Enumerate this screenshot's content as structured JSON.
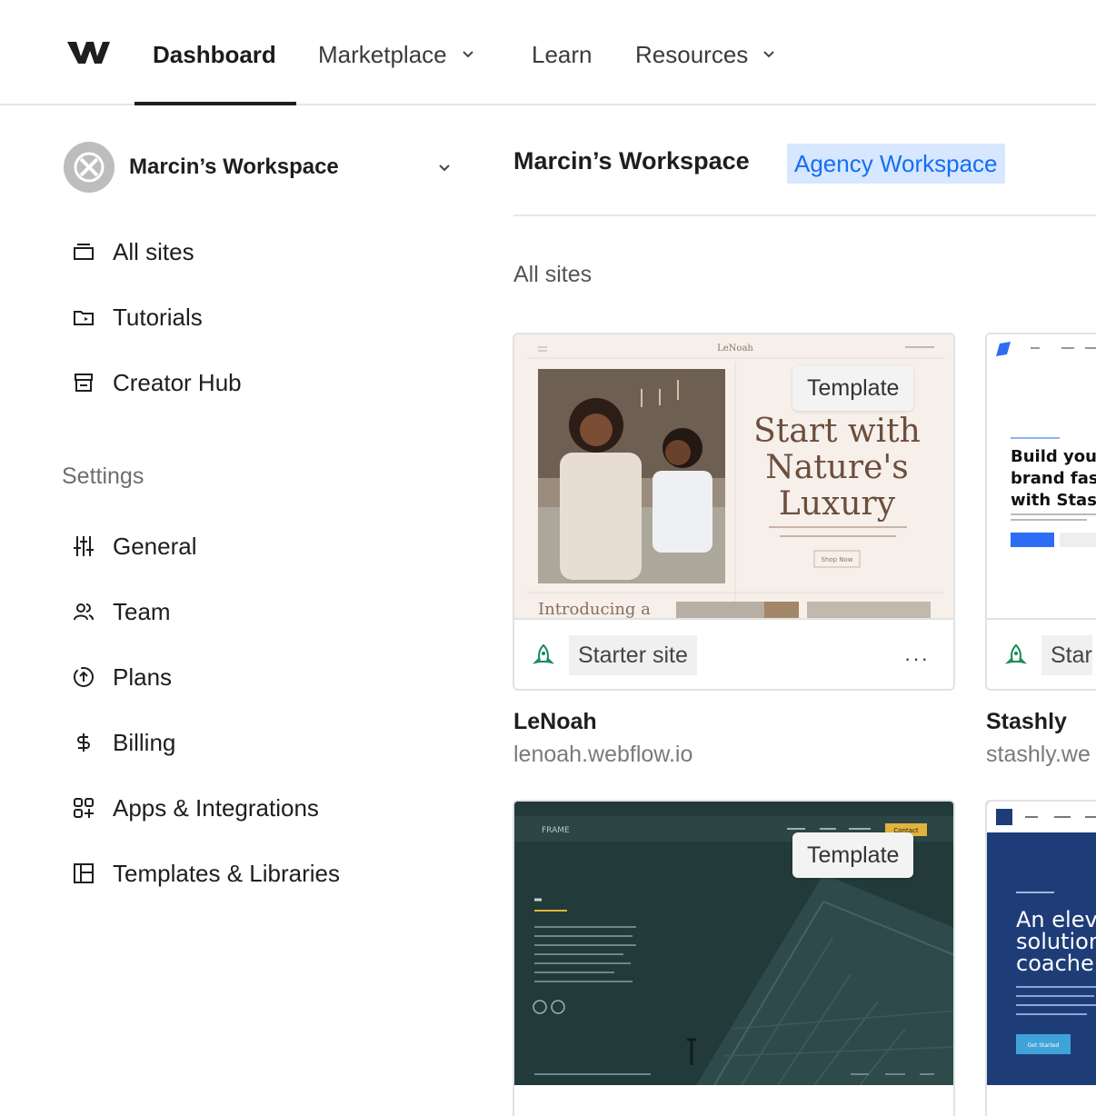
{
  "nav": {
    "logo": "webflow-logo",
    "items": [
      {
        "label": "Dashboard",
        "active": true
      },
      {
        "label": "Marketplace",
        "dropdown": true
      },
      {
        "label": "Learn"
      },
      {
        "label": "Resources",
        "dropdown": true
      }
    ]
  },
  "sidebar": {
    "workspace_name": "Marcin’s Workspace",
    "items": [
      {
        "label": "All sites",
        "icon": "sites-icon"
      },
      {
        "label": "Tutorials",
        "icon": "tutorials-icon"
      },
      {
        "label": "Creator Hub",
        "icon": "store-icon"
      }
    ],
    "settings_heading": "Settings",
    "settings_items": [
      {
        "label": "General",
        "icon": "sliders-icon"
      },
      {
        "label": "Team",
        "icon": "team-icon"
      },
      {
        "label": "Plans",
        "icon": "plans-icon"
      },
      {
        "label": "Billing",
        "icon": "dollar-icon"
      },
      {
        "label": "Apps & Integrations",
        "icon": "apps-icon"
      },
      {
        "label": "Templates & Libraries",
        "icon": "templates-icon"
      }
    ]
  },
  "main": {
    "workspace_title": "Marcin’s Workspace",
    "workspace_badge": "Agency Workspace",
    "section_label": "All sites",
    "sites": [
      {
        "name": "LeNoah",
        "url": "lenoah.webflow.io",
        "template_badge": "Template",
        "plan": "Starter site",
        "more": "···",
        "preview": {
          "brand": "LeNoah",
          "headline": [
            "Start with",
            "Nature's",
            "Luxury"
          ],
          "teaser": "Introducing a",
          "cta": "Shop Now"
        }
      },
      {
        "name": "Stashly",
        "url": "stashly.we",
        "plan": "Star",
        "preview": {
          "headline": [
            "Build your",
            "brand fast",
            "with Stash"
          ]
        }
      },
      {
        "template_badge": "Template",
        "preview": {
          "brand": "FRAME",
          "cta": "Contact"
        }
      },
      {
        "preview": {
          "headline": [
            "An elev",
            "solution",
            "coache"
          ],
          "cta": "Get Started"
        }
      }
    ]
  },
  "colors": {
    "accent": "#146ef5",
    "badge_bg": "#d6e7ff",
    "rocket": "#1a8a5a"
  }
}
